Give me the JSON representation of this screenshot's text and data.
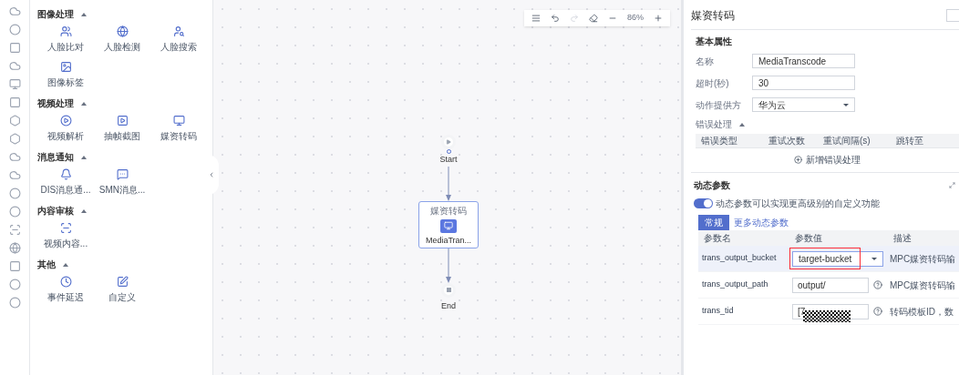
{
  "palette": {
    "groups": [
      {
        "title": "图像处理",
        "expanded": true,
        "items": [
          {
            "label": "人脸比对"
          },
          {
            "label": "人脸检测"
          },
          {
            "label": "人脸搜索"
          },
          {
            "label": "图像标签"
          }
        ]
      },
      {
        "title": "视频处理",
        "expanded": true,
        "items": [
          {
            "label": "视频解析"
          },
          {
            "label": "抽帧截图"
          },
          {
            "label": "媒资转码"
          }
        ]
      },
      {
        "title": "消息通知",
        "expanded": true,
        "items": [
          {
            "label": "DIS消息通..."
          },
          {
            "label": "SMN消息..."
          }
        ]
      },
      {
        "title": "内容审核",
        "expanded": true,
        "items": [
          {
            "label": "视频内容..."
          }
        ]
      },
      {
        "title": "其他",
        "expanded": true,
        "items": [
          {
            "label": "事件延迟"
          },
          {
            "label": "自定义"
          }
        ]
      }
    ]
  },
  "toolbar": {
    "redo_disabled": true,
    "zoom": "86%"
  },
  "flow": {
    "start": "Start",
    "task": {
      "title": "媒资转码",
      "label": "MediaTran...",
      "selected": true
    },
    "end": "End"
  },
  "panel": {
    "title": "媒资转码",
    "section": "基本属性",
    "fields": [
      {
        "label": "名称",
        "value": "MediaTranscode",
        "kind": "text"
      },
      {
        "label": "超时(秒)",
        "value": "30",
        "kind": "text"
      },
      {
        "label": "动作提供方",
        "value": "华为云",
        "kind": "select"
      }
    ],
    "error_handling": {
      "title": "错误处理",
      "expanded": true,
      "columns": [
        "错误类型",
        "重试次数",
        "重试间隔(s)",
        "跳转至"
      ],
      "add": "新增错误处理"
    },
    "dynamic": {
      "title": "动态参数",
      "toggle": {
        "on": true,
        "label": "动态参数可以实现更高级别的自定义功能"
      },
      "tabs": [
        {
          "label": "常规",
          "selected": true
        },
        {
          "label": "更多动态参数",
          "selected": false
        }
      ],
      "columns": [
        "参数名",
        "参数值",
        "描述"
      ],
      "rows": [
        {
          "name": "trans_output_bucket",
          "value": "target-bucket",
          "kind": "select",
          "selected": true,
          "annotated": true,
          "description": "MPC媒资转码输"
        },
        {
          "name": "trans_output_path",
          "value": "output/",
          "kind": "text",
          "selected": false,
          "annotated": false,
          "description": "MPC媒资转码输"
        },
        {
          "name": "trans_tid",
          "value": "[7",
          "kind": "text",
          "selected": false,
          "annotated": false,
          "redacted": true,
          "description": "转码模板ID，数"
        }
      ]
    }
  }
}
